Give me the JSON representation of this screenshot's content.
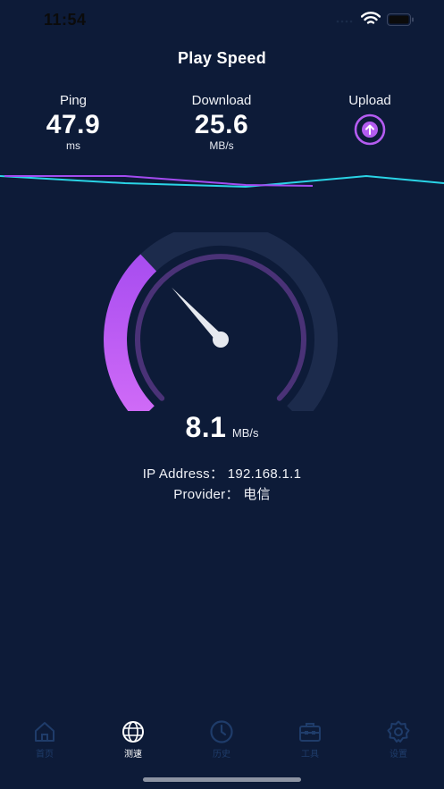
{
  "status_bar": {
    "time": "11:54"
  },
  "page_title": "Play Speed",
  "metrics": {
    "ping": {
      "label": "Ping",
      "value": "47.9",
      "unit": "ms"
    },
    "download": {
      "label": "Download",
      "value": "25.6",
      "unit": "MB/s"
    },
    "upload": {
      "label": "Upload",
      "icon": "arrow-up-circle-icon"
    }
  },
  "gauge": {
    "value": "8.1",
    "unit": "MB/s",
    "fill_fraction": 0.34
  },
  "network": {
    "ip_text": "IP  Address： 192.168.1.1",
    "provider_text": "Provider： 电信"
  },
  "tabs": [
    {
      "label": "首页",
      "icon": "home-icon",
      "active": false
    },
    {
      "label": "测速",
      "icon": "globe-icon",
      "active": true
    },
    {
      "label": "历史",
      "icon": "clock-icon",
      "active": false
    },
    {
      "label": "工具",
      "icon": "toolbox-icon",
      "active": false
    },
    {
      "label": "设置",
      "icon": "gear-icon",
      "active": false
    }
  ],
  "colors": {
    "background": "#0d1b38",
    "accent_purple": "#b45cf0",
    "accent_cyan": "#2ad4e6",
    "inactive_tab": "#1f3c6a"
  }
}
